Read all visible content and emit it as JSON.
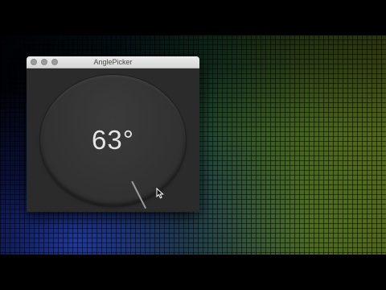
{
  "window": {
    "title": "AnglePicker"
  },
  "angle_picker": {
    "display": "63°",
    "angle_degrees": 63
  },
  "icons": {
    "close": "close-icon",
    "minimize": "minimize-icon",
    "zoom": "zoom-icon",
    "cursor": "mouse-pointer-icon"
  }
}
